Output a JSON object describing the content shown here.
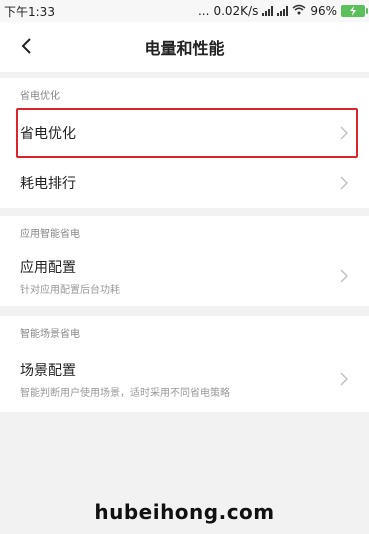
{
  "status_bar": {
    "time": "下午1:33",
    "dots": "...",
    "network_speed": "0.02K/s",
    "battery_percent": "96%"
  },
  "header": {
    "title": "电量和性能",
    "back_icon": "chevron-left-icon"
  },
  "sections": [
    {
      "header": "省电优化",
      "items": [
        {
          "title": "省电优化",
          "highlighted": true
        },
        {
          "title": "耗电排行"
        }
      ]
    },
    {
      "header": "应用智能省电",
      "items": [
        {
          "title": "应用配置",
          "subtitle": "针对应用配置后台功耗"
        }
      ]
    },
    {
      "header": "智能场景省电",
      "items": [
        {
          "title": "场景配置",
          "subtitle": "智能判断用户使用场景，适时采用不同省电策略"
        }
      ]
    }
  ],
  "watermark": "hubeihong.com",
  "colors": {
    "highlight_border": "#d9252b",
    "battery": "#5bbf5b",
    "background": "#f2f2f2"
  }
}
